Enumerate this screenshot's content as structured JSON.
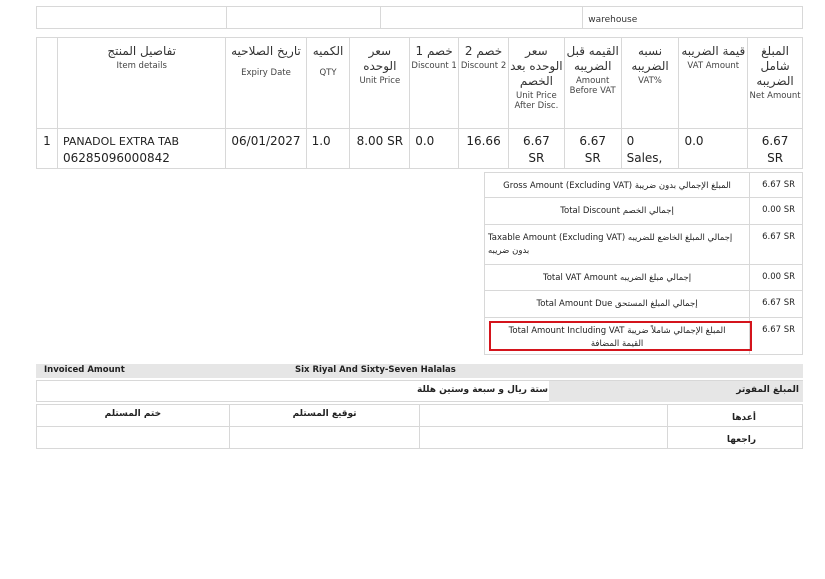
{
  "top": {
    "warehouse_label": "warehouse"
  },
  "columns": [
    {
      "ar": "تفاصيل المنتج",
      "en": "Item details"
    },
    {
      "ar": "تاريخ الصلاحيه",
      "en": "Expiry Date"
    },
    {
      "ar": "الكميه",
      "en": "QTY"
    },
    {
      "ar": "سعر الوحده",
      "en": "Unit Price"
    },
    {
      "ar": "خصم 1",
      "en": "Discount 1"
    },
    {
      "ar": "خصم 2",
      "en": "Discount 2"
    },
    {
      "ar": "سعر الوحده بعد الخصم",
      "en": "Unit Price After Disc."
    },
    {
      "ar": "القيمه قبل الضريبه",
      "en": "Amount Before VAT"
    },
    {
      "ar": "نسبه الضريبه",
      "en": "VAT%"
    },
    {
      "ar": "قيمة الضريبه",
      "en": "VAT Amount"
    },
    {
      "ar": "المبلغ شامل الضريبه",
      "en": "Net Amount"
    }
  ],
  "items": [
    {
      "no": "1",
      "name": "PANADOL EXTRA TAB",
      "barcode": "06285096000842",
      "expiry": "06/01/2027",
      "qty": "1.0",
      "unit_price": "8.00 SR",
      "discount1": "0.0",
      "discount2": "16.66",
      "price_after_disc": "6.67 SR",
      "amount_before_vat": "6.67 SR",
      "vat_percent": "0 Sales,",
      "vat_amount": "0.0",
      "net_amount": "6.67 SR"
    }
  ],
  "totals": [
    {
      "label": "Gross Amount (Excluding VAT) المبلغ الإجمالي بدون ضريبة",
      "value": "6.67 SR"
    },
    {
      "label": "Total Discount إجمالي الخصم",
      "value": "0.00 SR"
    },
    {
      "label": "Taxable Amount (Excluding VAT) إجمالي المبلغ الخاضع للضريبه بدون ضريبه",
      "value": "6.67 SR"
    },
    {
      "label": "Total VAT Amount إجمالي مبلغ الضريبه",
      "value": "0.00 SR"
    },
    {
      "label": "Total Amount Due إجمالي المبلغ المستحق",
      "value": "6.67 SR"
    },
    {
      "label": "Total Amount Including VAT المبلغ الإجمالي شاملاً ضريبة القيمة المضافة",
      "value": "6.67 SR"
    }
  ],
  "invoiced": {
    "label": "Invoiced Amount",
    "words_en": "Six Riyal And Sixty-Seven Halalas"
  },
  "amount_words": {
    "ar": "ستة ريال و سبعة وستين هللة",
    "label": "المبلغ المفوتر"
  },
  "signatures": {
    "receiver_stamp": "ختم المستلم",
    "receiver_signature": "توقيع المستلم",
    "prepared_by": "أعدها",
    "reviewed_by": "راجعها"
  },
  "colors": {
    "highlight_border": "#d4141c",
    "label_background": "#e6e6e6"
  }
}
